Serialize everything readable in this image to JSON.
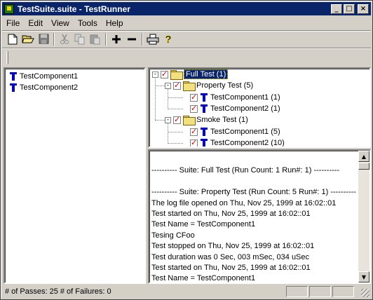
{
  "window": {
    "title": "TestSuite.suite - TestRunner"
  },
  "menu": [
    "File",
    "Edit",
    "View",
    "Tools",
    "Help"
  ],
  "toolbar": [
    "new-file-icon",
    "open-folder-icon",
    "save-icon",
    "cut-icon",
    "copy-icon",
    "paste-icon",
    "add-icon",
    "remove-icon",
    "print-icon",
    "help-icon"
  ],
  "components": [
    "TestComponent1",
    "TestComponent2"
  ],
  "tree": {
    "root": "Full Test (1)",
    "groups": [
      {
        "label": "Property Test (5)",
        "items": [
          "TestComponent1 (1)",
          "TestComponent2 (1)"
        ]
      },
      {
        "label": "Smoke Test (1)",
        "items": [
          "TestComponent1 (5)",
          "TestComponent2 (10)"
        ]
      }
    ]
  },
  "log": [
    "",
    "---------- Suite: Full Test (Run Count: 1  Run#: 1) ----------",
    "",
    "---------- Suite: Property Test (Run Count: 5  Run#: 1) ----------",
    "The log file opened on Thu, Nov 25, 1999 at 16:02::01",
    "Test started on Thu, Nov 25, 1999 at 16:02::01",
    "Test Name = TestComponent1",
    "Tesing CFoo",
    "Test stopped on Thu, Nov 25, 1999 at 16:02::01",
    "Test duration was   0 Sec, 003 mSec, 034 uSec",
    "Test started on Thu, Nov 25, 1999 at 16:02::01",
    "Test Name = TestComponent1"
  ],
  "status": {
    "text": "# of Passes: 25   # of Failures: 0"
  }
}
